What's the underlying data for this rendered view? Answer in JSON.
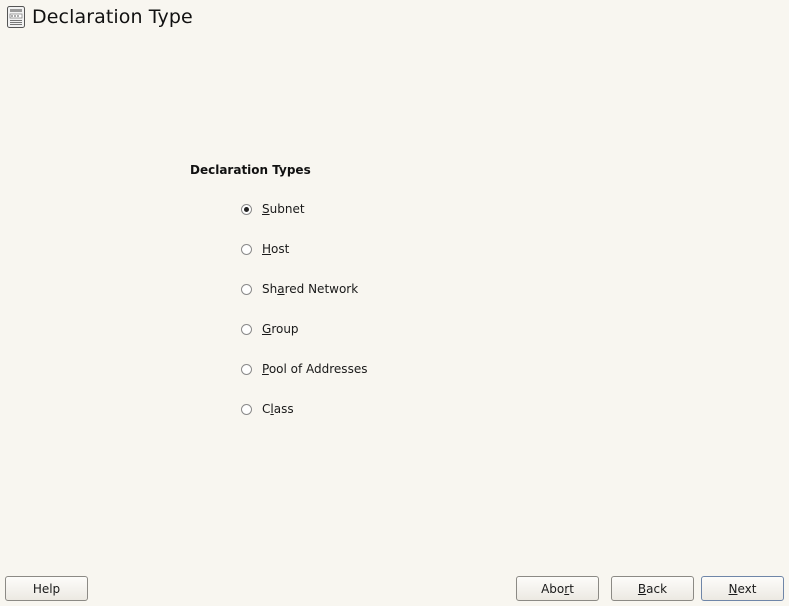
{
  "header": {
    "icon": "server-config-icon",
    "title": "Declaration Type"
  },
  "group": {
    "title": "Declaration Types",
    "selected": "Subnet",
    "options": [
      {
        "pre": "",
        "key": "S",
        "post": "ubnet",
        "checked": true
      },
      {
        "pre": "",
        "key": "H",
        "post": "ost",
        "checked": false
      },
      {
        "pre": "Sh",
        "key": "a",
        "post": "red Network",
        "checked": false
      },
      {
        "pre": "",
        "key": "G",
        "post": "roup",
        "checked": false
      },
      {
        "pre": "",
        "key": "P",
        "post": "ool of Addresses",
        "checked": false
      },
      {
        "pre": "C",
        "key": "l",
        "post": "ass",
        "checked": false
      }
    ]
  },
  "buttons": {
    "help": {
      "pre": "Help",
      "key": "",
      "post": ""
    },
    "abort": {
      "pre": "Abo",
      "key": "r",
      "post": "t"
    },
    "back": {
      "pre": "",
      "key": "B",
      "post": "ack"
    },
    "next": {
      "pre": "",
      "key": "N",
      "post": "ext"
    }
  }
}
